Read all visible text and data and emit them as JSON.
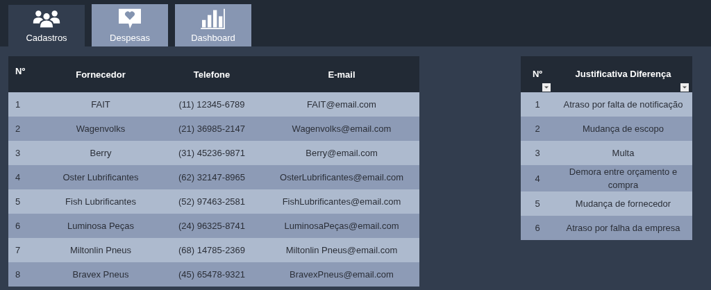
{
  "tabs": [
    {
      "label": "Cadastros",
      "kind": "people",
      "selected": true
    },
    {
      "label": "Despesas",
      "kind": "chat-heart",
      "selected": false
    },
    {
      "label": "Dashboard",
      "kind": "bars",
      "selected": false
    }
  ],
  "suppliers": {
    "columns": [
      "Nº",
      "Fornecedor",
      "Telefone",
      "E-mail"
    ],
    "rows": [
      [
        "1",
        "FAIT",
        "(11) 12345-6789",
        "FAIT@email.com"
      ],
      [
        "2",
        "Wagenvolks",
        "(21) 36985-2147",
        "Wagenvolks@email.com"
      ],
      [
        "3",
        "Berry",
        "(31) 45236-9871",
        "Berry@email.com"
      ],
      [
        "4",
        "Oster Lubrificantes",
        "(62) 32147-8965",
        "OsterLubrificantes@email.com"
      ],
      [
        "5",
        "Fish Lubrificantes",
        "(52) 97463-2581",
        "FishLubrificantes@email.com"
      ],
      [
        "6",
        "Luminosa Peças",
        "(24) 96325-8741",
        "LuminosaPeças@email.com"
      ],
      [
        "7",
        "Miltonlin Pneus",
        "(68) 14785-2369",
        "Miltonlin Pneus@email.com"
      ],
      [
        "8",
        "Bravex Pneus",
        "(45) 65478-9321",
        "BravexPneus@email.com"
      ]
    ]
  },
  "justifications": {
    "columns": [
      "Nº",
      "Justificativa Diferença"
    ],
    "rows": [
      [
        "1",
        "Atraso por falta de notificação"
      ],
      [
        "2",
        "Mudança de escopo"
      ],
      [
        "3",
        "Multa"
      ],
      [
        "4",
        "Demora entre orçamento e compra"
      ],
      [
        "5",
        "Mudança de fornecedor"
      ],
      [
        "6",
        "Atraso por falha da empresa"
      ]
    ]
  }
}
